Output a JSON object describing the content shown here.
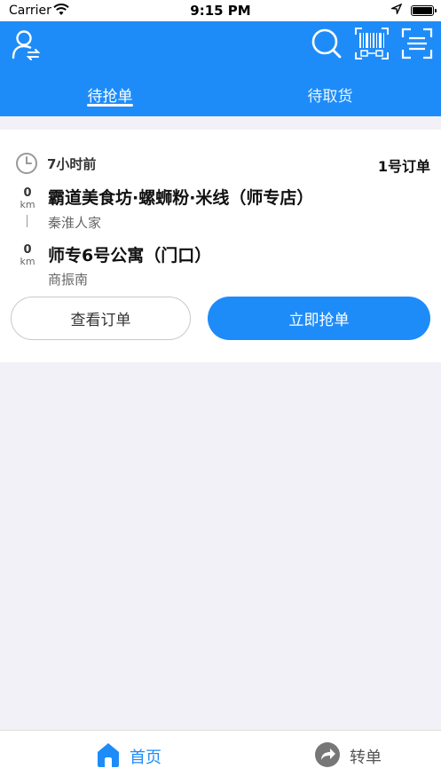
{
  "status_bar": {
    "carrier": "Carrier",
    "time": "9:15 PM"
  },
  "header": {
    "icons": [
      "user-switch-icon",
      "search-icon",
      "barcode-icon",
      "scan-icon"
    ],
    "tabs": [
      {
        "label": "待抢单",
        "active": true
      },
      {
        "label": "待取货",
        "active": false
      }
    ]
  },
  "order": {
    "time_ago": "7小时前",
    "order_no": "1号订单",
    "pickup": {
      "distance": "0",
      "unit": "km",
      "name": "霸道美食坊·螺蛳粉·米线（师专店）",
      "sub": "秦淮人家"
    },
    "dropoff": {
      "distance": "0",
      "unit": "km",
      "name": "师专6号公寓（门口）",
      "sub": "商振南"
    },
    "view_label": "查看订单",
    "grab_label": "立即抢单"
  },
  "tabbar": {
    "items": [
      {
        "label": "首页",
        "icon": "home-icon",
        "active": true
      },
      {
        "label": "转单",
        "icon": "transfer-icon",
        "active": false
      }
    ]
  },
  "colors": {
    "accent": "#1e8cf8",
    "background": "#f2f1f7"
  }
}
